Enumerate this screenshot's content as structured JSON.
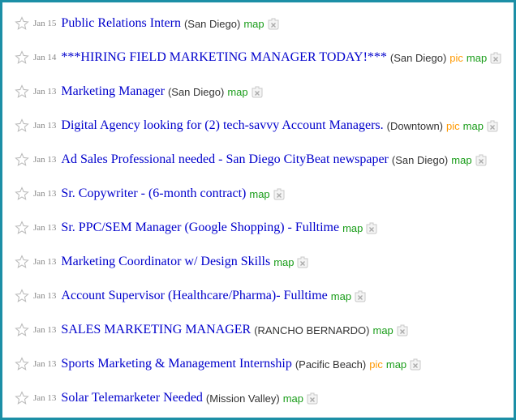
{
  "listings": [
    {
      "date": "Jan 15",
      "title": "Public Relations Intern",
      "location": "(San Diego)",
      "pic": "",
      "map": "map"
    },
    {
      "date": "Jan 14",
      "title": "***HIRING FIELD MARKETING MANAGER TODAY!***",
      "location": "(San Diego)",
      "pic": "pic",
      "map": "map"
    },
    {
      "date": "Jan 13",
      "title": "Marketing Manager",
      "location": "(San Diego)",
      "pic": "",
      "map": "map"
    },
    {
      "date": "Jan 13",
      "title": "Digital Agency looking for (2) tech-savvy Account Managers.",
      "location": "(Downtown)",
      "pic": "pic",
      "map": "map"
    },
    {
      "date": "Jan 13",
      "title": "Ad Sales Professional needed - San Diego CityBeat newspaper",
      "location": "(San Diego)",
      "pic": "",
      "map": "map"
    },
    {
      "date": "Jan 13",
      "title": "Sr. Copywriter - (6-month contract)",
      "location": "",
      "pic": "",
      "map": "map"
    },
    {
      "date": "Jan 13",
      "title": "Sr. PPC/SEM Manager (Google Shopping) - Fulltime",
      "location": "",
      "pic": "",
      "map": "map"
    },
    {
      "date": "Jan 13",
      "title": "Marketing Coordinator w/ Design Skills",
      "location": "",
      "pic": "",
      "map": "map"
    },
    {
      "date": "Jan 13",
      "title": "Account Supervisor (Healthcare/Pharma)- Fulltime",
      "location": "",
      "pic": "",
      "map": "map"
    },
    {
      "date": "Jan 13",
      "title": "SALES MARKETING MANAGER",
      "location": "(RANCHO BERNARDO)",
      "pic": "",
      "map": "map"
    },
    {
      "date": "Jan 13",
      "title": "Sports Marketing & Management Internship",
      "location": "(Pacific Beach)",
      "pic": "pic",
      "map": "map"
    },
    {
      "date": "Jan 13",
      "title": "Solar Telemarketer Needed",
      "location": "(Mission Valley)",
      "pic": "",
      "map": "map"
    }
  ],
  "icons": {
    "favorite": "star-icon",
    "hide": "hide-x-icon"
  },
  "colors": {
    "frame_border": "#1c8fa6",
    "title_link": "#0000cc",
    "map_link": "#1a9d1a",
    "pic_label": "#ff9900",
    "date_text": "#888888"
  }
}
